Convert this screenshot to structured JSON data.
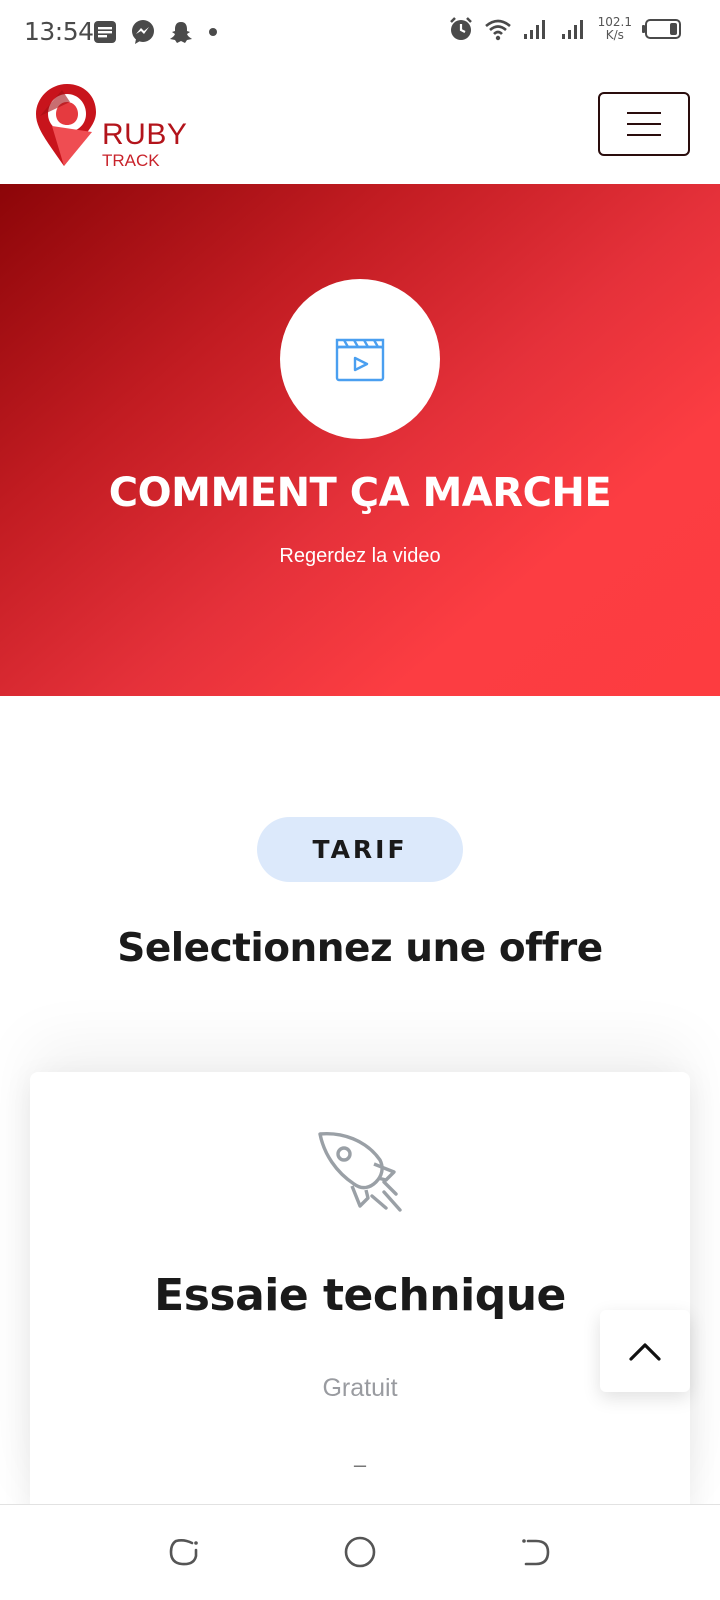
{
  "status_bar": {
    "time": "13:54",
    "speed_value": "102.1",
    "speed_unit": "K/s",
    "icons_left": [
      "notes-icon",
      "messenger-icon",
      "snapchat-icon",
      "dot-icon"
    ],
    "icons_right": [
      "alarm-icon",
      "wifi-icon",
      "signal-icon",
      "signal-icon",
      "battery-icon"
    ]
  },
  "header": {
    "logo_text_main": "RUBY",
    "logo_text_sub": "TRACK",
    "menu_icon": "hamburger-menu-icon"
  },
  "hero": {
    "icon": "video-clapperboard-icon",
    "title": "COMMENT ÇA MARCHE",
    "subtitle": "Regerdez la video",
    "colors": {
      "gradient_start": "#8c0508",
      "gradient_end": "#fd3c40",
      "icon": "#4a9ff0"
    }
  },
  "pricing": {
    "pill_label": "TARIF",
    "pill_color": "#dce9fb",
    "title": "Selectionnez une offre",
    "card": {
      "icon": "rocket-icon",
      "title": "Essaie technique",
      "price": "Gratuit",
      "dash": "–"
    }
  },
  "scroll_top": {
    "icon": "chevron-up-icon"
  },
  "navbar": {
    "icons": [
      "recent-apps-icon",
      "home-icon",
      "back-icon"
    ]
  }
}
